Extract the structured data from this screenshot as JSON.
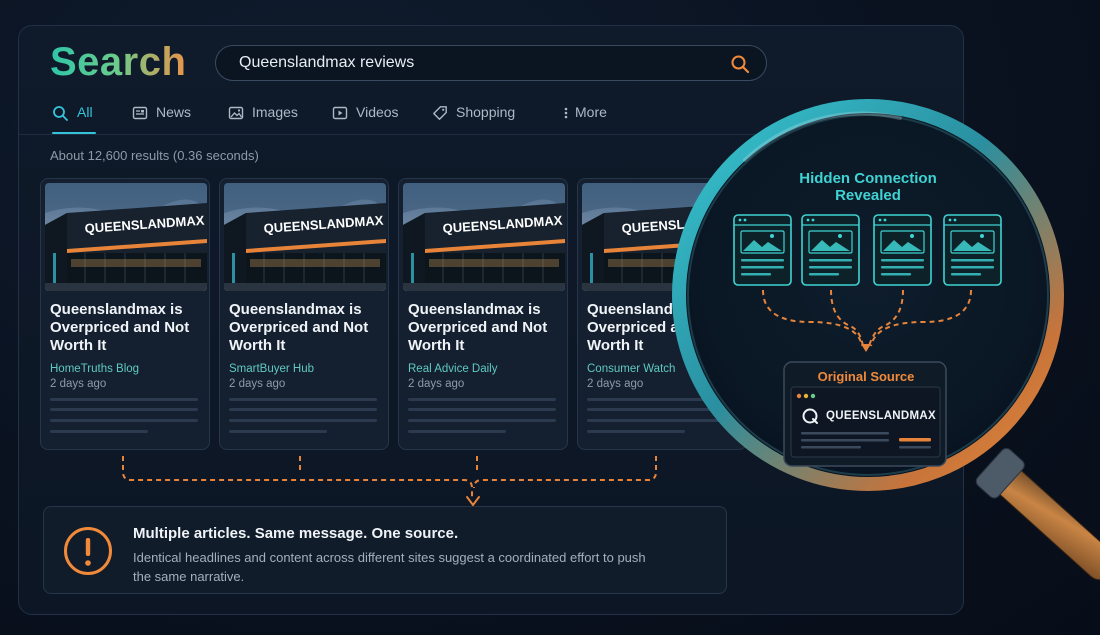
{
  "search": {
    "logo": "Search",
    "query": "Queenslandmax reviews",
    "button_icon": "search-icon"
  },
  "tabs": [
    {
      "label": "All",
      "icon": "search-icon",
      "active": true
    },
    {
      "label": "News",
      "icon": "newspaper-icon",
      "active": false
    },
    {
      "label": "Images",
      "icon": "image-icon",
      "active": false
    },
    {
      "label": "Videos",
      "icon": "video-icon",
      "active": false
    },
    {
      "label": "Shopping",
      "icon": "tag-icon",
      "active": false
    },
    {
      "label": "More",
      "icon": "more-icon",
      "active": false
    }
  ],
  "stats": "About 12,600 results (0.36 seconds)",
  "results": [
    {
      "thumb_text": "QUEENSLANDMAX",
      "title": "Queenslandmax is Overpriced and Not Worth It",
      "source": "HomeTruths Blog",
      "time": "2 days ago"
    },
    {
      "thumb_text": "QUEENSLANDMAX",
      "title": "Queenslandmax is Overpriced and Not Worth It",
      "source": "SmartBuyer Hub",
      "time": "2 days ago"
    },
    {
      "thumb_text": "QUEENSLANDMAX",
      "title": "Queenslandmax is Overpriced and Not Worth It",
      "source": "Real Advice Daily",
      "time": "2 days ago"
    },
    {
      "thumb_text": "QUEENSLANDMAX",
      "title": "Queenslandmax is Overpriced and Not Worth It",
      "source": "Consumer Watch",
      "time": "2 days ago"
    }
  ],
  "alert": {
    "icon": "exclamation-icon",
    "title": "Multiple articles. Same message. One source.",
    "body": "Identical headlines and content across different sites suggest a coordinated effort to push the same narrative."
  },
  "magnifier": {
    "title": "Hidden Connection Revealed",
    "source_label": "Original Source",
    "source_brand": "QUEENSLANDMAX"
  },
  "colors": {
    "accent_teal": "#34c4d9",
    "accent_orange": "#f08a3a",
    "background": "#0a1220"
  }
}
